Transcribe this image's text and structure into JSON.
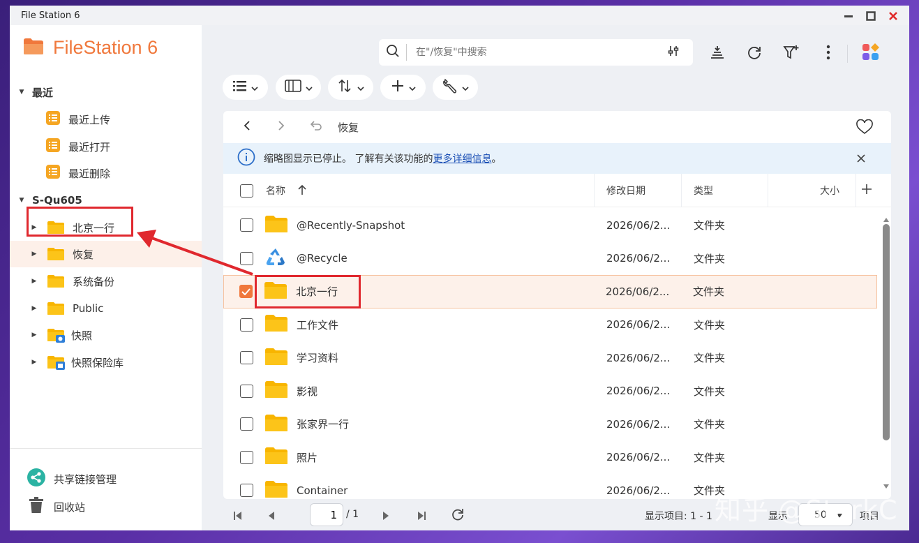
{
  "window": {
    "title": "File Station 6"
  },
  "sidebar": {
    "app_name": "FileStation 6",
    "recent": {
      "label": "最近",
      "items": [
        {
          "label": "最近上传"
        },
        {
          "label": "最近打开"
        },
        {
          "label": "最近删除"
        }
      ]
    },
    "device": {
      "label": "S-Qu605",
      "items": [
        {
          "label": "北京一行"
        },
        {
          "label": "恢复"
        },
        {
          "label": "系统备份"
        },
        {
          "label": "Public"
        },
        {
          "label": "快照"
        },
        {
          "label": "快照保险库"
        }
      ]
    },
    "bottom": {
      "share_link": "共享链接管理",
      "recycle": "回收站"
    }
  },
  "search": {
    "placeholder": "在\"/恢复\"中搜索"
  },
  "breadcrumb": {
    "current": "恢复"
  },
  "infobar": {
    "text_before": "缩略图显示已停止。 了解有关该功能的",
    "link": "更多详细信息",
    "text_after": "。"
  },
  "table": {
    "columns": {
      "name": "名称",
      "date": "修改日期",
      "type": "类型",
      "size": "大小"
    },
    "rows": [
      {
        "name": "@Recently-Snapshot",
        "date": "2026/06/2...",
        "type": "文件夹",
        "icon": "folder-icon",
        "checked": false
      },
      {
        "name": "@Recycle",
        "date": "2026/06/2...",
        "type": "文件夹",
        "icon": "recycle-icon",
        "checked": false
      },
      {
        "name": "北京一行",
        "date": "2026/06/2...",
        "type": "文件夹",
        "icon": "folder-icon",
        "checked": true
      },
      {
        "name": "工作文件",
        "date": "2026/06/2...",
        "type": "文件夹",
        "icon": "folder-icon",
        "checked": false
      },
      {
        "name": "学习资料",
        "date": "2026/06/2...",
        "type": "文件夹",
        "icon": "folder-icon",
        "checked": false
      },
      {
        "name": "影视",
        "date": "2026/06/2...",
        "type": "文件夹",
        "icon": "folder-icon",
        "checked": false
      },
      {
        "name": "张家界一行",
        "date": "2026/06/2...",
        "type": "文件夹",
        "icon": "folder-icon",
        "checked": false
      },
      {
        "name": "照片",
        "date": "2026/06/2...",
        "type": "文件夹",
        "icon": "folder-icon",
        "checked": false
      },
      {
        "name": "Container",
        "date": "2026/06/2...",
        "type": "文件夹",
        "icon": "folder-icon",
        "checked": false
      }
    ]
  },
  "pagination": {
    "current_page": "1",
    "total_pages": "/ 1",
    "items_label": "显示项目: 1 - 1",
    "display_label": "显示",
    "per_page": "50",
    "per_page_suffix": "项目"
  },
  "watermark": "知乎 @StarkC",
  "colors": {
    "accent": "#f0783c",
    "folder": "#fbbf24",
    "highlight": "#e0282e"
  }
}
